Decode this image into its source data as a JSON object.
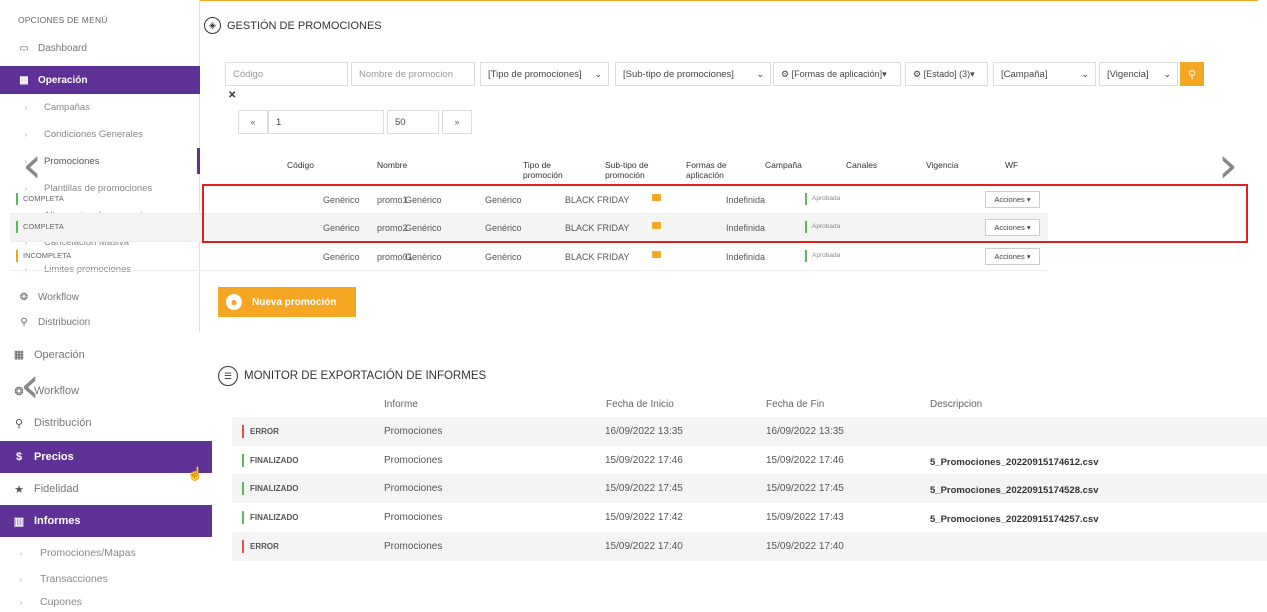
{
  "sidebar_top": {
    "title": "OPCIONES DE MENÚ",
    "items": [
      {
        "label": "Dashboard",
        "icon": "monitor-icon"
      },
      {
        "label": "Operación",
        "icon": "grid-icon"
      },
      {
        "label": "Campañas"
      },
      {
        "label": "Condiciones Generales"
      },
      {
        "label": "Promociones"
      },
      {
        "label": "Plantillas de promociones"
      },
      {
        "label": "Alta masiva de promociones"
      },
      {
        "label": "Cancelacion Masiva"
      },
      {
        "label": "Limites promociones"
      },
      {
        "label": "Workflow",
        "icon": "gear-icon"
      },
      {
        "label": "Distribucion",
        "icon": "pin-icon"
      }
    ]
  },
  "promos": {
    "title": "GESTIÓN DE PROMOCIONES",
    "filters": {
      "codigo_placeholder": "Código",
      "nombre_placeholder": "Nombre de promocion",
      "tipo": "[Tipo de promociones]",
      "subtipo": "[Sub-tipo de promociones]",
      "formas": "[Formas de aplicación]",
      "estado": "[Estado] (3)",
      "campana": "[Campaña]",
      "vigencia": "[Vigencia]"
    },
    "pager": {
      "page": "1",
      "size": "50"
    },
    "headers": {
      "codigo": "Código",
      "nombre": "Nombre",
      "tipo": "Tipo de promoción",
      "subtipo": "Sub-tipo de promoción",
      "formas": "Formas de aplicación",
      "campana": "Campaña",
      "canales": "Canales",
      "vigencia": "Vigencia",
      "wf": "WF"
    },
    "rows": [
      {
        "estado": "COMPLETA",
        "nombre": "promo1",
        "tipo": "Genérico",
        "subtipo": "Genérico",
        "formas": "Genérico",
        "campana": "BLACK FRIDAY",
        "vigencia": "Indefinida",
        "wf": "Aprobada",
        "acciones": "Acciones ▾"
      },
      {
        "estado": "COMPLETA",
        "nombre": "promo2",
        "tipo": "Genérico",
        "subtipo": "Genérico",
        "formas": "Genérico",
        "campana": "BLACK FRIDAY",
        "vigencia": "Indefinida",
        "wf": "Aprobada",
        "acciones": "Acciones ▾"
      },
      {
        "estado": "INCOMPLETA",
        "nombre": "promo01",
        "tipo": "Genérico",
        "subtipo": "Genérico",
        "formas": "Genérico",
        "campana": "BLACK FRIDAY",
        "vigencia": "Indefinida",
        "wf": "Aprobada",
        "acciones": "Acciones ▾"
      }
    ],
    "new_button": "Nueva promoción"
  },
  "sidebar_bottom": {
    "items": [
      {
        "label": "Operación"
      },
      {
        "label": "Workflow"
      },
      {
        "label": "Distribución"
      },
      {
        "label": "Precios"
      },
      {
        "label": "Fidelidad"
      },
      {
        "label": "Informes"
      },
      {
        "label": "Promociones/Mapas"
      },
      {
        "label": "Transacciones"
      },
      {
        "label": "Cupones"
      }
    ]
  },
  "monitor": {
    "title": "MONITOR DE EXPORTACIÓN DE INFORMES",
    "headers": {
      "informe": "Informe",
      "inicio": "Fecha de Inicio",
      "fin": "Fecha de Fin",
      "desc": "Descripcion"
    },
    "rows": [
      {
        "estado": "ERROR",
        "informe": "Promociones",
        "inicio": "16/09/2022 13:35",
        "fin": "16/09/2022 13:35",
        "desc": ""
      },
      {
        "estado": "FINALIZADO",
        "informe": "Promociones",
        "inicio": "15/09/2022 17:46",
        "fin": "15/09/2022 17:46",
        "desc": "5_Promociones_20220915174612.csv"
      },
      {
        "estado": "FINALIZADO",
        "informe": "Promociones",
        "inicio": "15/09/2022 17:45",
        "fin": "15/09/2022 17:45",
        "desc": "5_Promociones_20220915174528.csv"
      },
      {
        "estado": "FINALIZADO",
        "informe": "Promociones",
        "inicio": "15/09/2022 17:42",
        "fin": "15/09/2022 17:43",
        "desc": "5_Promociones_20220915174257.csv"
      },
      {
        "estado": "ERROR",
        "informe": "Promociones",
        "inicio": "15/09/2022 17:40",
        "fin": "15/09/2022 17:40",
        "desc": ""
      }
    ]
  }
}
